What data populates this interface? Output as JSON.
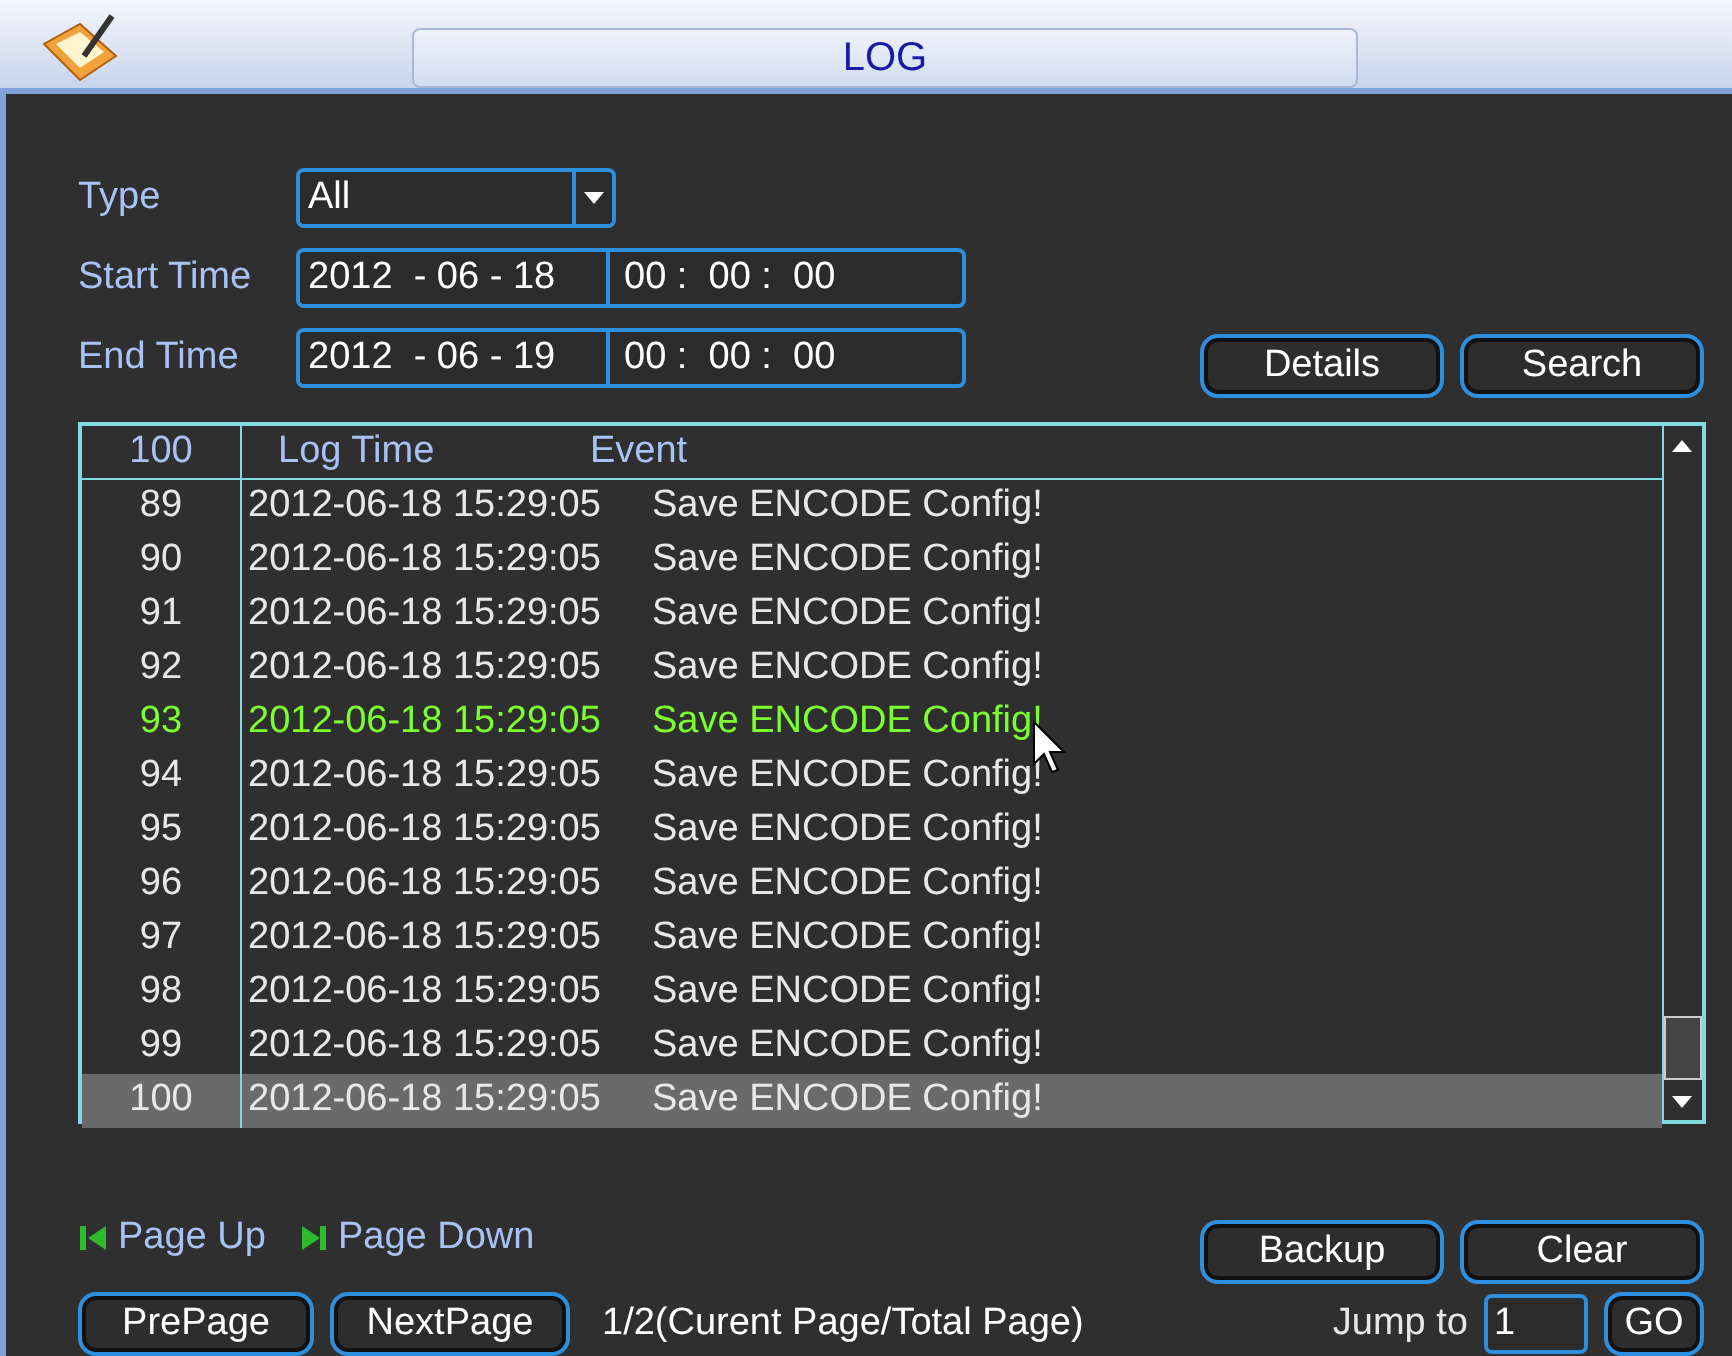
{
  "window": {
    "title": "LOG"
  },
  "filters": {
    "type_label": "Type",
    "type_value": "All",
    "start_label": "Start Time",
    "start_date": "2012  - 06 - 18",
    "start_time": "00 :  00 :  00",
    "end_label": "End Time",
    "end_date": "2012  - 06 - 19",
    "end_time": "00 :  00 :  00"
  },
  "top_buttons": [
    "Details",
    "Search"
  ],
  "table": {
    "columns": [
      "100",
      "Log Time",
      "Event"
    ],
    "rows": [
      {
        "no": "89",
        "time": "2012-06-18 15:29:05",
        "event": "Save ENCODE Config!",
        "hovered": false,
        "selected": false
      },
      {
        "no": "90",
        "time": "2012-06-18 15:29:05",
        "event": "Save ENCODE Config!",
        "hovered": false,
        "selected": false
      },
      {
        "no": "91",
        "time": "2012-06-18 15:29:05",
        "event": "Save ENCODE Config!",
        "hovered": false,
        "selected": false
      },
      {
        "no": "92",
        "time": "2012-06-18 15:29:05",
        "event": "Save ENCODE Config!",
        "hovered": false,
        "selected": false
      },
      {
        "no": "93",
        "time": "2012-06-18 15:29:05",
        "event": "Save ENCODE Config!",
        "hovered": true,
        "selected": false
      },
      {
        "no": "94",
        "time": "2012-06-18 15:29:05",
        "event": "Save ENCODE Config!",
        "hovered": false,
        "selected": false
      },
      {
        "no": "95",
        "time": "2012-06-18 15:29:05",
        "event": "Save ENCODE Config!",
        "hovered": false,
        "selected": false
      },
      {
        "no": "96",
        "time": "2012-06-18 15:29:05",
        "event": "Save ENCODE Config!",
        "hovered": false,
        "selected": false
      },
      {
        "no": "97",
        "time": "2012-06-18 15:29:05",
        "event": "Save ENCODE Config!",
        "hovered": false,
        "selected": false
      },
      {
        "no": "98",
        "time": "2012-06-18 15:29:05",
        "event": "Save ENCODE Config!",
        "hovered": false,
        "selected": false
      },
      {
        "no": "99",
        "time": "2012-06-18 15:29:05",
        "event": "Save ENCODE Config!",
        "hovered": false,
        "selected": false
      },
      {
        "no": "100",
        "time": "2012-06-18 15:29:05",
        "event": "Save ENCODE Config!",
        "hovered": false,
        "selected": true
      }
    ]
  },
  "page_keys": [
    "Page Up",
    "Page Down"
  ],
  "bottom_buttons": [
    "Backup",
    "Clear"
  ],
  "pager": {
    "prev": "PrePage",
    "next": "NextPage",
    "info": "1/2(Curent Page/Total Page)",
    "jump_label": "Jump to",
    "jump_value": "1",
    "go": "GO"
  }
}
